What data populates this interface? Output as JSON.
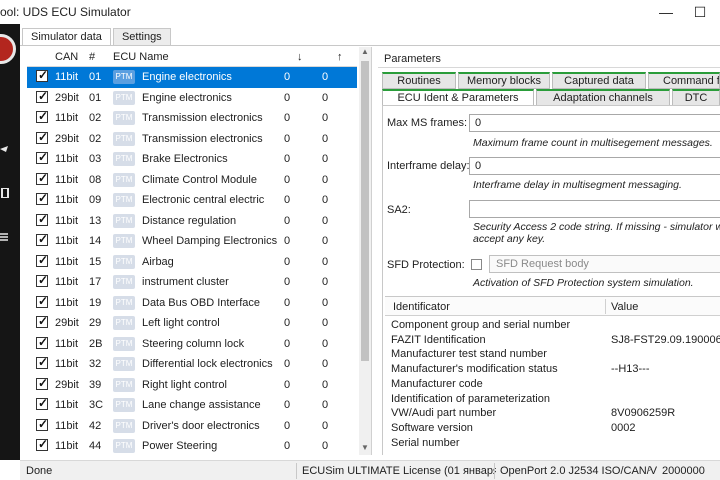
{
  "window": {
    "title": "ool: UDS ECU Simulator",
    "minimize": "—",
    "maximize": "☐"
  },
  "main_tabs": [
    {
      "label": "Simulator data",
      "active": true
    },
    {
      "label": "Settings",
      "active": false
    }
  ],
  "ecu_table": {
    "headers": {
      "can": "CAN",
      "num": "#",
      "name": "ECU Name",
      "down": "↓",
      "up": "↑"
    },
    "badge": "PTM",
    "rows": [
      {
        "can": "11bit",
        "num": "01",
        "name": "Engine electronics",
        "down": "0",
        "up": "0",
        "selected": true
      },
      {
        "can": "29bit",
        "num": "01",
        "name": "Engine electronics",
        "down": "0",
        "up": "0"
      },
      {
        "can": "11bit",
        "num": "02",
        "name": "Transmission electronics",
        "down": "0",
        "up": "0"
      },
      {
        "can": "29bit",
        "num": "02",
        "name": "Transmission electronics",
        "down": "0",
        "up": "0"
      },
      {
        "can": "11bit",
        "num": "03",
        "name": "Brake Electronics",
        "down": "0",
        "up": "0"
      },
      {
        "can": "11bit",
        "num": "08",
        "name": "Climate Control Module",
        "down": "0",
        "up": "0"
      },
      {
        "can": "11bit",
        "num": "09",
        "name": "Electronic central electric",
        "down": "0",
        "up": "0"
      },
      {
        "can": "11bit",
        "num": "13",
        "name": "Distance regulation",
        "down": "0",
        "up": "0"
      },
      {
        "can": "11bit",
        "num": "14",
        "name": "Wheel Damping Electronics",
        "down": "0",
        "up": "0"
      },
      {
        "can": "11bit",
        "num": "15",
        "name": "Airbag",
        "down": "0",
        "up": "0"
      },
      {
        "can": "11bit",
        "num": "17",
        "name": "instrument cluster",
        "down": "0",
        "up": "0"
      },
      {
        "can": "11bit",
        "num": "19",
        "name": "Data Bus OBD Interface",
        "down": "0",
        "up": "0"
      },
      {
        "can": "29bit",
        "num": "29",
        "name": "Left light control",
        "down": "0",
        "up": "0"
      },
      {
        "can": "11bit",
        "num": "2B",
        "name": "Steering column lock",
        "down": "0",
        "up": "0"
      },
      {
        "can": "11bit",
        "num": "32",
        "name": "Differential lock electronics",
        "down": "0",
        "up": "0"
      },
      {
        "can": "29bit",
        "num": "39",
        "name": "Right light control",
        "down": "0",
        "up": "0"
      },
      {
        "can": "11bit",
        "num": "3C",
        "name": "Lane change assistance",
        "down": "0",
        "up": "0"
      },
      {
        "can": "11bit",
        "num": "42",
        "name": "Driver's door electronics",
        "down": "0",
        "up": "0"
      },
      {
        "can": "11bit",
        "num": "44",
        "name": "Power Steering",
        "down": "0",
        "up": "0"
      }
    ]
  },
  "parameters": {
    "title": "Parameters",
    "tabs_row1": [
      "Routines",
      "Memory blocks",
      "Captured data",
      "Command flo"
    ],
    "tabs_row2": [
      "ECU Ident & Parameters",
      "Adaptation channels",
      "DTC"
    ],
    "max_ms_frames": {
      "label": "Max MS frames:",
      "value": "0",
      "hint": "Maximum frame count in multisegement messages."
    },
    "interframe_delay": {
      "label": "Interframe delay:",
      "value": "0",
      "hint": "Interframe delay in multisegment messaging."
    },
    "sa2": {
      "label": "SA2:",
      "value": "",
      "hint": "Security Access 2 code string. If missing - simulator will accept any key."
    },
    "sfd": {
      "label": "SFD Protection:",
      "select_placeholder": "SFD Request body",
      "hint": "Activation of SFD Protection system simulation."
    },
    "ident_table": {
      "headers": {
        "identificator": "Identificator",
        "value": "Value"
      },
      "rows": [
        {
          "id": "Component group and serial number",
          "value": ""
        },
        {
          "id": "FAZIT Identification",
          "value": "SJ8-FST29.09.1900061884"
        },
        {
          "id": "Manufacturer test stand number",
          "value": ""
        },
        {
          "id": "Manufacturer's modification status",
          "value": "--H13---"
        },
        {
          "id": "Manufacturer code",
          "value": ""
        },
        {
          "id": "Identification of parameterization",
          "value": ""
        },
        {
          "id": "VW/Audi part number",
          "value": "8V0906259R"
        },
        {
          "id": "Software version",
          "value": "0002"
        },
        {
          "id": "Serial number",
          "value": ""
        }
      ]
    }
  },
  "statusbar": {
    "status": "Done",
    "license": "ECUSim ULTIMATE License (01 января 2023)",
    "adapter": "OpenPort 2.0 J2534 ISO/CAN/VPW",
    "baud": "2000000"
  }
}
